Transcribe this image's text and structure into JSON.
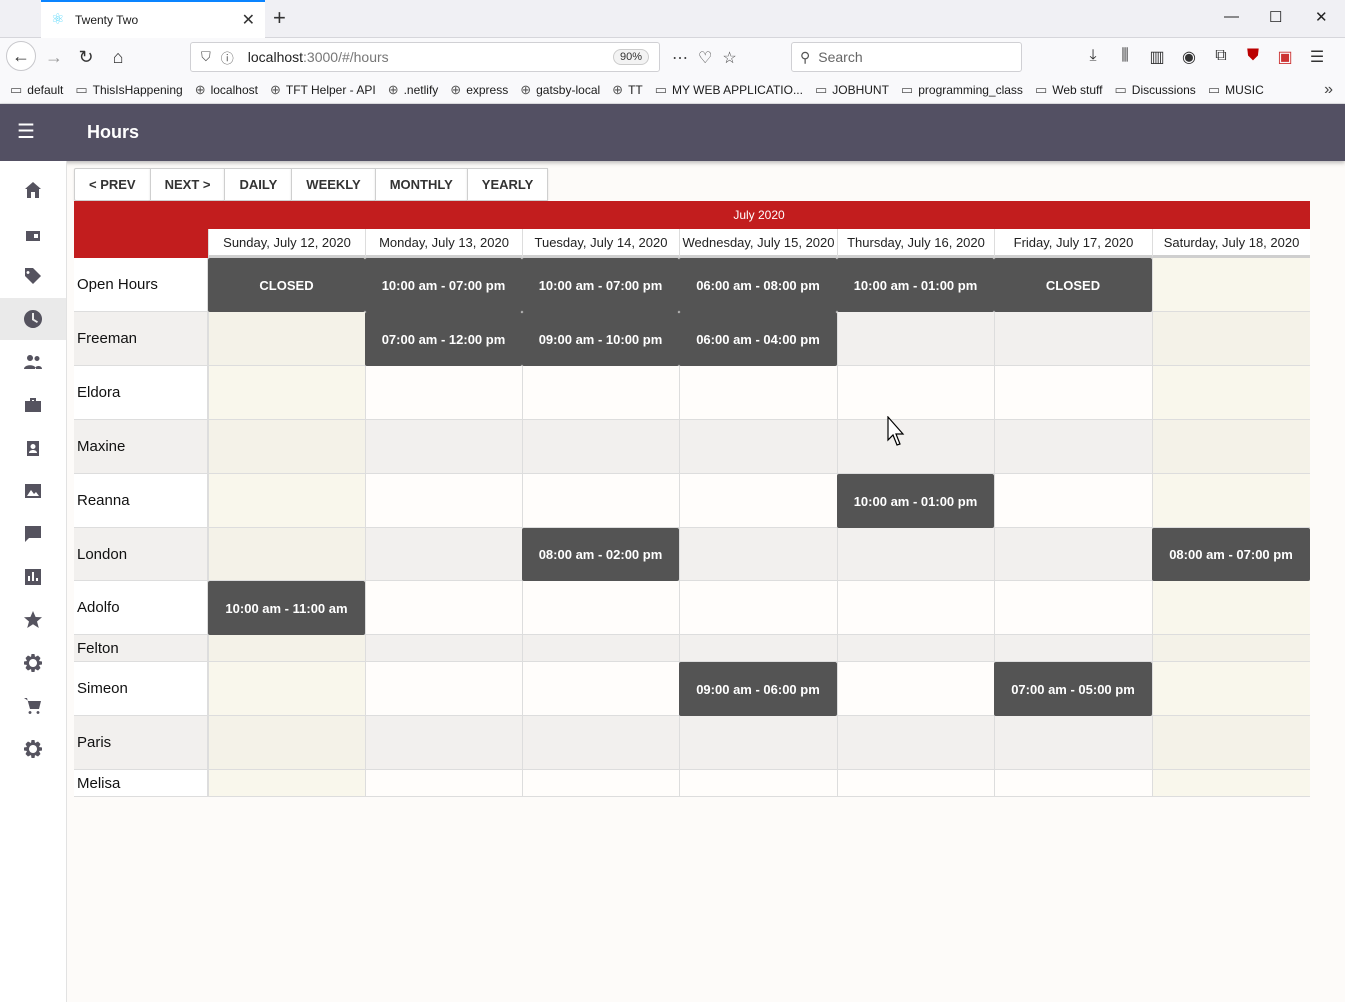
{
  "browser": {
    "tab_title": "Twenty Two",
    "url_host": "localhost",
    "url_rest": ":3000/#/hours",
    "zoom": "90%",
    "search_placeholder": "Search",
    "bookmarks": [
      {
        "label": "default",
        "icon": "folder-icon"
      },
      {
        "label": "ThisIsHappening",
        "icon": "folder-icon"
      },
      {
        "label": "localhost",
        "icon": "globe-icon"
      },
      {
        "label": "TFT Helper - API",
        "icon": "globe-icon"
      },
      {
        "label": ".netlify",
        "icon": "globe-icon"
      },
      {
        "label": "express",
        "icon": "globe-icon"
      },
      {
        "label": "gatsby-local",
        "icon": "globe-icon"
      },
      {
        "label": "TT",
        "icon": "globe-icon"
      },
      {
        "label": "MY WEB APPLICATIO...",
        "icon": "folder-icon"
      },
      {
        "label": "JOBHUNT",
        "icon": "folder-icon"
      },
      {
        "label": "programming_class",
        "icon": "folder-icon"
      },
      {
        "label": "Web stuff",
        "icon": "folder-icon"
      },
      {
        "label": "Discussions",
        "icon": "folder-icon"
      },
      {
        "label": "MUSIC",
        "icon": "folder-icon"
      }
    ]
  },
  "app": {
    "title": "Hours",
    "nav": [
      "home-icon",
      "calendar-icon",
      "tag-icon",
      "clock-icon",
      "people-icon",
      "briefcase-icon",
      "contact-icon",
      "image-icon",
      "chat-icon",
      "chart-icon",
      "star-icon",
      "gear-icon",
      "cart-icon",
      "settings-icon"
    ],
    "active_nav": "clock-icon"
  },
  "toolbar": {
    "prev": "< PREV",
    "next": "NEXT >",
    "daily": "DAILY",
    "weekly": "WEEKLY",
    "monthly": "MONTHLY",
    "yearly": "YEARLY"
  },
  "calendar": {
    "month": "July 2020",
    "days": [
      "Sunday, July 12, 2020",
      "Monday, July 13, 2020",
      "Tuesday, July 14, 2020",
      "Wednesday, July 15, 2020",
      "Thursday, July 16, 2020",
      "Friday, July 17, 2020",
      "Saturday, July 18, 2020"
    ],
    "rows": [
      {
        "name": "Open Hours",
        "shifts": [
          "CLOSED",
          "10:00 am - 07:00 pm",
          "10:00 am - 07:00 pm",
          "06:00 am - 08:00 pm",
          "10:00 am - 01:00 pm",
          "CLOSED",
          ""
        ]
      },
      {
        "name": "Freeman",
        "shifts": [
          "",
          "07:00 am - 12:00 pm",
          "09:00 am - 10:00 pm",
          "06:00 am - 04:00 pm",
          "",
          "",
          ""
        ]
      },
      {
        "name": "Eldora",
        "shifts": [
          "",
          "",
          "",
          "",
          "",
          "",
          ""
        ]
      },
      {
        "name": "Maxine",
        "shifts": [
          "",
          "",
          "",
          "",
          "",
          "",
          ""
        ]
      },
      {
        "name": "Reanna",
        "shifts": [
          "",
          "",
          "",
          "",
          "10:00 am - 01:00 pm",
          "",
          ""
        ]
      },
      {
        "name": "London",
        "shifts": [
          "",
          "",
          "08:00 am - 02:00 pm",
          "",
          "",
          "",
          "08:00 am - 07:00 pm"
        ]
      },
      {
        "name": "Adolfo",
        "shifts": [
          "10:00 am - 11:00 am",
          "",
          "",
          "",
          "",
          "",
          ""
        ]
      },
      {
        "name": "Felton",
        "shifts": [
          "",
          "",
          "",
          "",
          "",
          "",
          ""
        ]
      },
      {
        "name": "Simeon",
        "shifts": [
          "",
          "",
          "",
          "09:00 am - 06:00 pm",
          "",
          "07:00 am - 05:00 pm",
          ""
        ]
      },
      {
        "name": "Paris",
        "shifts": [
          "",
          "",
          "",
          "",
          "",
          "",
          ""
        ]
      },
      {
        "name": "Melisa",
        "shifts": [
          "",
          "",
          "",
          "",
          "",
          "",
          ""
        ]
      }
    ]
  },
  "colors": {
    "header_red": "#c21d1e",
    "appbar": "#535063",
    "event": "#545454",
    "weekend_tint": "#f9f7ec",
    "alt_row": "#f2f0ee"
  }
}
